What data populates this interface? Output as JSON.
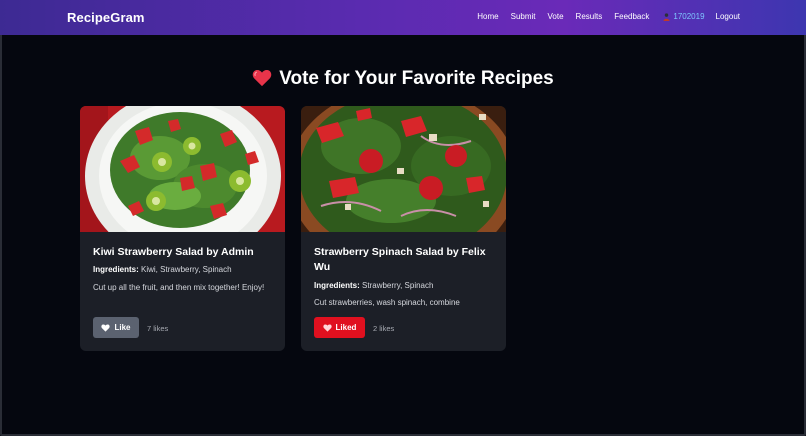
{
  "colors": {
    "page_bg": "#05070f",
    "card_bg": "#1c1f27",
    "like_button": "#5b6270",
    "liked_button": "#e0101f",
    "user_link": "#7fc6ff",
    "heart": "#e8344a"
  },
  "navbar": {
    "brand": "RecipeGram",
    "links": [
      "Home",
      "Submit",
      "Vote",
      "Results",
      "Feedback"
    ],
    "user_id": "1702019",
    "user_icon": "user-icon",
    "logout": "Logout"
  },
  "heading": {
    "icon": "heart-icon",
    "text": "Vote for Your Favorite Recipes"
  },
  "recipes": [
    {
      "title": "Kiwi Strawberry Salad by Admin",
      "ingredients_label": "Ingredients:",
      "ingredients": "Kiwi, Strawberry, Spinach",
      "description": "Cut up all the fruit, and then mix together! Enjoy!",
      "button_label": "Like",
      "button_state": "not-liked",
      "likes": "7 likes",
      "image": "kiwi-strawberry-salad-photo"
    },
    {
      "title": "Strawberry Spinach Salad by Felix Wu",
      "ingredients_label": "Ingredients:",
      "ingredients": "Strawberry, Spinach",
      "description": "Cut strawberries, wash spinach, combine",
      "button_label": "Liked",
      "button_state": "liked",
      "likes": "2 likes",
      "image": "strawberry-spinach-salad-photo"
    }
  ]
}
